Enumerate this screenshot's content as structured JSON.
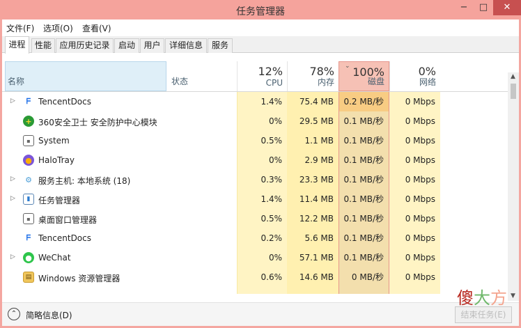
{
  "window": {
    "title": "任务管理器",
    "min": "−",
    "max": "□",
    "close": "✕"
  },
  "menu": [
    "文件(F)",
    "选项(O)",
    "查看(V)"
  ],
  "tabs": [
    "进程",
    "性能",
    "应用历史记录",
    "启动",
    "用户",
    "详细信息",
    "服务"
  ],
  "header": {
    "name": "名称",
    "status": "状态",
    "cpu": {
      "pct": "12%",
      "label": "CPU"
    },
    "memory": {
      "pct": "78%",
      "label": "内存"
    },
    "disk": {
      "pct": "100%",
      "label": "磁盘"
    },
    "network": {
      "pct": "0%",
      "label": "网络"
    }
  },
  "processes": [
    {
      "name": "TencentDocs",
      "icon": "tencentdocs-icon",
      "expand": true,
      "cpu": "1.4%",
      "mem": "75.4 MB",
      "disk": "0.2 MB/秒",
      "net": "0 Mbps"
    },
    {
      "name": "360安全卫士 安全防护中心模块",
      "icon": "360-shield-icon",
      "expand": false,
      "cpu": "0%",
      "mem": "29.5 MB",
      "disk": "0.1 MB/秒",
      "net": "0 Mbps"
    },
    {
      "name": "System",
      "icon": "system-icon",
      "expand": false,
      "cpu": "0.5%",
      "mem": "1.1 MB",
      "disk": "0.1 MB/秒",
      "net": "0 Mbps"
    },
    {
      "name": "HaloTray",
      "icon": "halotray-icon",
      "expand": false,
      "cpu": "0%",
      "mem": "2.9 MB",
      "disk": "0.1 MB/秒",
      "net": "0 Mbps"
    },
    {
      "name": "服务主机: 本地系统 (18)",
      "icon": "service-host-icon",
      "expand": true,
      "cpu": "0.3%",
      "mem": "23.3 MB",
      "disk": "0.1 MB/秒",
      "net": "0 Mbps"
    },
    {
      "name": "任务管理器",
      "icon": "task-manager-icon",
      "expand": true,
      "cpu": "1.4%",
      "mem": "11.4 MB",
      "disk": "0.1 MB/秒",
      "net": "0 Mbps"
    },
    {
      "name": "桌面窗口管理器",
      "icon": "desktop-window-manager-icon",
      "expand": false,
      "cpu": "0.5%",
      "mem": "12.2 MB",
      "disk": "0.1 MB/秒",
      "net": "0 Mbps"
    },
    {
      "name": "TencentDocs",
      "icon": "tencentdocs-icon",
      "expand": false,
      "cpu": "0.2%",
      "mem": "5.6 MB",
      "disk": "0.1 MB/秒",
      "net": "0 Mbps"
    },
    {
      "name": "WeChat",
      "icon": "wechat-icon",
      "expand": true,
      "cpu": "0%",
      "mem": "57.1 MB",
      "disk": "0.1 MB/秒",
      "net": "0 Mbps"
    },
    {
      "name": "Windows 资源管理器",
      "icon": "file-explorer-icon",
      "expand": false,
      "cpu": "0.6%",
      "mem": "14.6 MB",
      "disk": "0 MB/秒",
      "net": "0 Mbps"
    }
  ],
  "footer": {
    "fewer_details": "简略信息(D)",
    "end_task": "结束任务(E)"
  },
  "watermark": {
    "a": "傻",
    "b": "大",
    "c": "方"
  }
}
